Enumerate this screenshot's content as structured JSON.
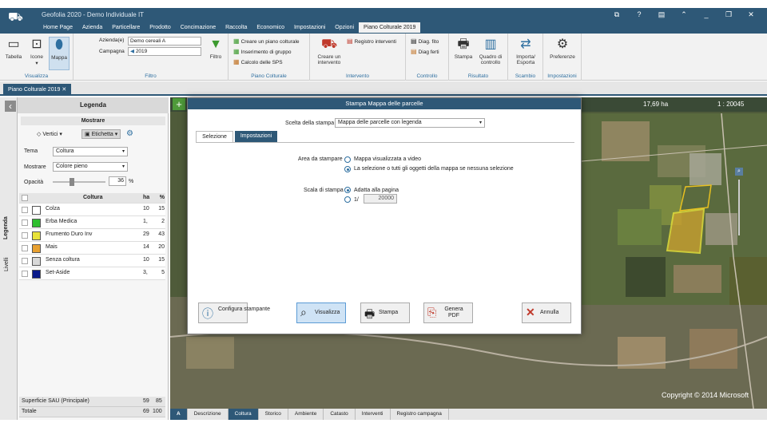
{
  "app": {
    "title": "Geofolia 2020 - Demo Individuale IT"
  },
  "menu": [
    "Home Page",
    "Azienda",
    "Particellare",
    "Prodotto",
    "Concimazione",
    "Raccolta",
    "Economico",
    "Impostazioni",
    "Opzioni",
    "Piano Colturale 2019"
  ],
  "ribbon": {
    "visualizza": {
      "group": "Visualizza",
      "tabella": "Tabella",
      "icone": "Icone",
      "mappa": "Mappa"
    },
    "filtro": {
      "group": "Filtro",
      "azienda_label": "Azienda(e)",
      "azienda_value": "Demo cereali A",
      "campagna_label": "Campagna",
      "campagna_value": "2019",
      "filtro": "Filtro"
    },
    "piano": {
      "group": "Piano Colturale",
      "crea": "Creare un piano colturale",
      "inserimento": "Inserimento di gruppo",
      "calcolo": "Calcolo delle SPS"
    },
    "intervento": {
      "group": "Intervento",
      "creare": "Creare un intervento",
      "registro": "Registro interventi"
    },
    "controllo": {
      "group": "Controllo",
      "diag_fito": "Diag. fito",
      "diag_ferti": "Diag ferti"
    },
    "risultato": {
      "group": "Risultato",
      "stampa": "Stampa",
      "quadro": "Quadro di controllo"
    },
    "scambio": {
      "group": "Scambio",
      "importa": "Importa/ Esporta"
    },
    "impostazioni": {
      "group": "Impostazioni",
      "preferenze": "Preferenze"
    }
  },
  "doc_tab": "Piano Colturale 2019",
  "legend": {
    "title": "Legenda",
    "vtabs": [
      "Legenda",
      "Livelli"
    ],
    "mostrare_header": "Mostrare",
    "vertici": "Vertici",
    "etichetta": "Etichetta",
    "tema_label": "Tema",
    "tema_value": "Coltura",
    "mostrare_label": "Mostrare",
    "mostrare_value": "Colore pieno",
    "opacita_label": "Opacità",
    "opacita_value": "36",
    "opacita_unit": "%",
    "columns": {
      "coltura": "Coltura",
      "ha": "ha",
      "pct": "%"
    },
    "rows": [
      {
        "name": "Colza",
        "ha": "10",
        "pct": "15",
        "color": "#ffffff"
      },
      {
        "name": "Erba Medica",
        "ha": "1,",
        "pct": "2",
        "color": "#2fbf2f"
      },
      {
        "name": "Frumento Duro Inv",
        "ha": "29",
        "pct": "43",
        "color": "#e8e23a"
      },
      {
        "name": "Mais",
        "ha": "14",
        "pct": "20",
        "color": "#e8a030"
      },
      {
        "name": "Senza coltura",
        "ha": "10",
        "pct": "15",
        "color": "#d8d8d8"
      },
      {
        "name": "Set-Aside",
        "ha": "3,",
        "pct": "5",
        "color": "#0a1a8a"
      }
    ],
    "footer": [
      {
        "label": "Superficie SAU (Principale)",
        "ha": "59",
        "pct": "85"
      },
      {
        "label": "Totale",
        "ha": "69",
        "pct": "100"
      }
    ]
  },
  "map": {
    "area": "17,69 ha",
    "scale": "1 : 20045",
    "copyright": "Copyright © 2014 Microsoft"
  },
  "dialog": {
    "title": "Stampa Mappa delle parcelle",
    "scelta_label": "Scelta della stampa",
    "scelta_value": "Mappa delle parcelle con legenda",
    "tabs": [
      "Selezione",
      "Impostazioni"
    ],
    "area_label": "Area da stampare",
    "area_opt1": "Mappa visualizzata a video",
    "area_opt2": "La selezione o tutti gli oggetti della mappa se nessuna selezione",
    "scala_label": "Scala di stampa",
    "scala_opt1": "Adatta alla pagina",
    "scala_opt2": "1/",
    "scala_value": "20000",
    "buttons": {
      "configura": "Configura stampante",
      "visualizza": "Visualizza",
      "stampa": "Stampa",
      "genera": "Genera PDF",
      "annulla": "Annulla"
    }
  },
  "bottom_tabs": [
    "Descrizione",
    "Coltura",
    "Storico",
    "Ambiente",
    "Catasto",
    "Interventi",
    "Registro campagna"
  ]
}
